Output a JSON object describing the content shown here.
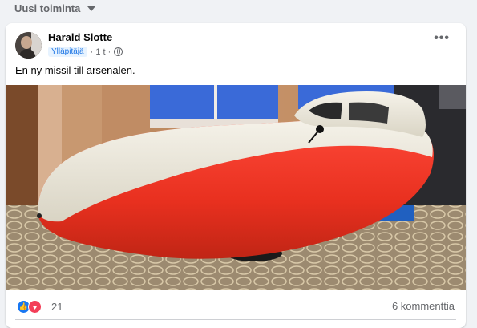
{
  "feed": {
    "sort_label": "Uusi toiminta"
  },
  "post": {
    "author": "Harald Slotte",
    "role": "Ylläpitäjä",
    "time": "· 1 t ·",
    "text": "En ny missil till arsenalen.",
    "reactions_count": "21",
    "comments": "6 kommenttia"
  },
  "colors": {
    "background": "#f0f2f5",
    "card": "#ffffff",
    "like": "#1877f2",
    "love": "#f33e58",
    "secondary_text": "#65676b"
  },
  "icons": [
    "chevron-down-icon",
    "globe-icon",
    "more-options-icon",
    "like-reaction-icon",
    "love-reaction-icon"
  ]
}
